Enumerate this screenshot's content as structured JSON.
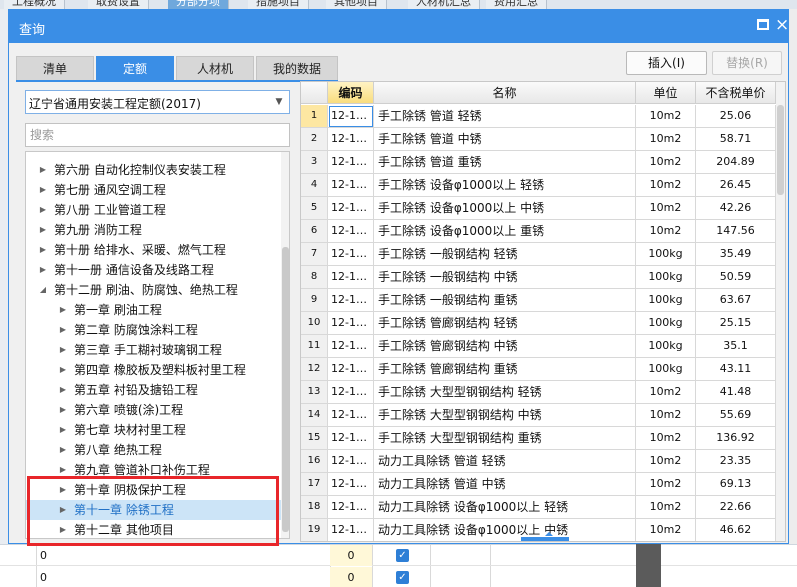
{
  "background_app": {
    "tabs": [
      "工程概况",
      "取费设置",
      "分部分项",
      "措施项目",
      "其他项目",
      "人材机汇总",
      "费用汇总"
    ],
    "active_tab_index": 2,
    "bottom_rows": [
      {
        "zero_a": "0",
        "zero_b": "0",
        "checked": true
      },
      {
        "zero_a": "0",
        "zero_b": "0",
        "checked": true
      }
    ]
  },
  "dialog": {
    "title": "查询",
    "close_symbol": "×",
    "tabs": [
      {
        "label": "清单",
        "active": false
      },
      {
        "label": "定额",
        "active": true
      },
      {
        "label": "人材机",
        "active": false
      },
      {
        "label": "我的数据",
        "active": false
      }
    ],
    "insert_button": "插入(I)",
    "replace_button": "替换(R)",
    "quota_select": "辽宁省通用安装工程定额(2017)",
    "search_placeholder": "搜索"
  },
  "tree": [
    {
      "label": "第六册 自动化控制仪表安装工程",
      "level": 1,
      "expanded": false,
      "selected": false
    },
    {
      "label": "第七册 通风空调工程",
      "level": 1,
      "expanded": false,
      "selected": false
    },
    {
      "label": "第八册 工业管道工程",
      "level": 1,
      "expanded": false,
      "selected": false
    },
    {
      "label": "第九册 消防工程",
      "level": 1,
      "expanded": false,
      "selected": false
    },
    {
      "label": "第十册 给排水、采暖、燃气工程",
      "level": 1,
      "expanded": false,
      "selected": false
    },
    {
      "label": "第十一册 通信设备及线路工程",
      "level": 1,
      "expanded": false,
      "selected": false
    },
    {
      "label": "第十二册 刷油、防腐蚀、绝热工程",
      "level": 1,
      "expanded": true,
      "selected": false
    },
    {
      "label": "第一章 刷油工程",
      "level": 2,
      "expanded": false,
      "selected": false
    },
    {
      "label": "第二章 防腐蚀涂料工程",
      "level": 2,
      "expanded": false,
      "selected": false
    },
    {
      "label": "第三章 手工糊衬玻璃钢工程",
      "level": 2,
      "expanded": false,
      "selected": false
    },
    {
      "label": "第四章 橡胶板及塑料板衬里工程",
      "level": 2,
      "expanded": false,
      "selected": false
    },
    {
      "label": "第五章 衬铅及搪铅工程",
      "level": 2,
      "expanded": false,
      "selected": false
    },
    {
      "label": "第六章 喷镀(涂)工程",
      "level": 2,
      "expanded": false,
      "selected": false
    },
    {
      "label": "第七章 块材衬里工程",
      "level": 2,
      "expanded": false,
      "selected": false
    },
    {
      "label": "第八章 绝热工程",
      "level": 2,
      "expanded": false,
      "selected": false
    },
    {
      "label": "第九章 管道补口补伤工程",
      "level": 2,
      "expanded": false,
      "selected": false
    },
    {
      "label": "第十章 阴极保护工程",
      "level": 2,
      "expanded": false,
      "selected": false
    },
    {
      "label": "第十一章 除锈工程",
      "level": 2,
      "expanded": false,
      "selected": true
    },
    {
      "label": "第十二章 其他项目",
      "level": 2,
      "expanded": false,
      "selected": false
    }
  ],
  "table": {
    "headers": [
      "编码",
      "名称",
      "单位",
      "不含税单价"
    ],
    "rows": [
      {
        "num": "1",
        "code": "12-1…",
        "name": "手工除锈 管道 轻锈",
        "unit": "10m2",
        "price": "25.06"
      },
      {
        "num": "2",
        "code": "12-1…",
        "name": "手工除锈 管道 中锈",
        "unit": "10m2",
        "price": "58.71"
      },
      {
        "num": "3",
        "code": "12-1…",
        "name": "手工除锈 管道 重锈",
        "unit": "10m2",
        "price": "204.89"
      },
      {
        "num": "4",
        "code": "12-1…",
        "name": "手工除锈 设备φ1000以上 轻锈",
        "unit": "10m2",
        "price": "26.45"
      },
      {
        "num": "5",
        "code": "12-1…",
        "name": "手工除锈 设备φ1000以上 中锈",
        "unit": "10m2",
        "price": "42.26"
      },
      {
        "num": "6",
        "code": "12-1…",
        "name": "手工除锈 设备φ1000以上 重锈",
        "unit": "10m2",
        "price": "147.56"
      },
      {
        "num": "7",
        "code": "12-1…",
        "name": "手工除锈 一般钢结构 轻锈",
        "unit": "100kg",
        "price": "35.49"
      },
      {
        "num": "8",
        "code": "12-1…",
        "name": "手工除锈 一般钢结构 中锈",
        "unit": "100kg",
        "price": "50.59"
      },
      {
        "num": "9",
        "code": "12-1…",
        "name": "手工除锈 一般钢结构 重锈",
        "unit": "100kg",
        "price": "63.67"
      },
      {
        "num": "10",
        "code": "12-1…",
        "name": "手工除锈 管廊钢结构 轻锈",
        "unit": "100kg",
        "price": "25.15"
      },
      {
        "num": "11",
        "code": "12-1…",
        "name": "手工除锈 管廊钢结构 中锈",
        "unit": "100kg",
        "price": "35.1"
      },
      {
        "num": "12",
        "code": "12-1…",
        "name": "手工除锈 管廊钢结构 重锈",
        "unit": "100kg",
        "price": "43.11"
      },
      {
        "num": "13",
        "code": "12-1…",
        "name": "手工除锈 大型型钢钢结构 轻锈",
        "unit": "10m2",
        "price": "41.48"
      },
      {
        "num": "14",
        "code": "12-1…",
        "name": "手工除锈 大型型钢钢结构 中锈",
        "unit": "10m2",
        "price": "55.69"
      },
      {
        "num": "15",
        "code": "12-1…",
        "name": "手工除锈 大型型钢钢结构 重锈",
        "unit": "10m2",
        "price": "136.92"
      },
      {
        "num": "16",
        "code": "12-1…",
        "name": "动力工具除锈 管道 轻锈",
        "unit": "10m2",
        "price": "23.35"
      },
      {
        "num": "17",
        "code": "12-1…",
        "name": "动力工具除锈 管道 中锈",
        "unit": "10m2",
        "price": "69.13"
      },
      {
        "num": "18",
        "code": "12-1…",
        "name": "动力工具除锈 设备φ1000以上 轻锈",
        "unit": "10m2",
        "price": "22.66"
      },
      {
        "num": "19",
        "code": "12-1…",
        "name": "动力工具除锈 设备φ1000以上 中锈",
        "unit": "10m2",
        "price": "46.62"
      }
    ]
  },
  "colors": {
    "accent": "#3a8ee6",
    "highlight_border": "#e8262a",
    "selected_row": "#cce4f7",
    "header_selected": "#f9dd7e"
  }
}
